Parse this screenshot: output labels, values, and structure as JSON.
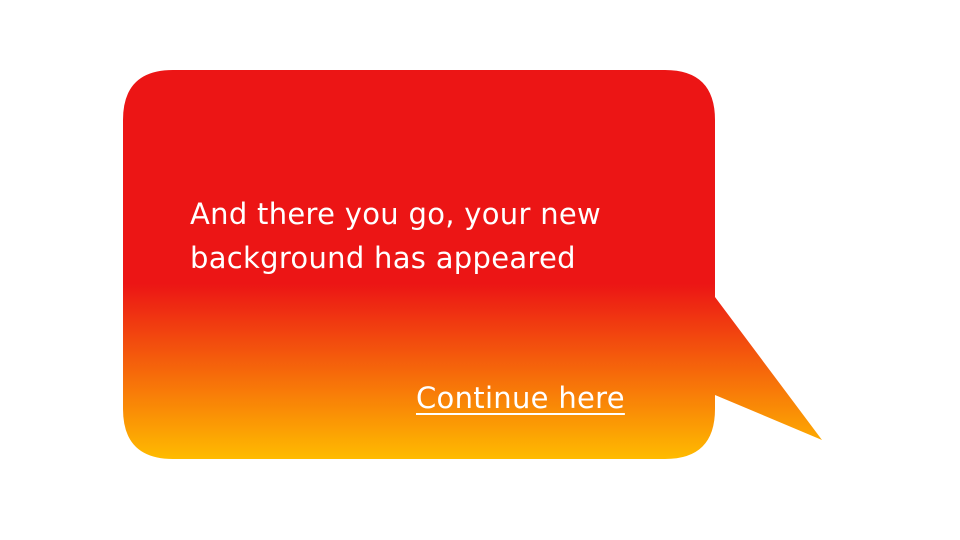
{
  "bubble": {
    "message": "And there you go, your new\nbackground has appeared",
    "continue_label": "Continue here",
    "colors": {
      "gradient_top": "#ec1515",
      "gradient_bottom": "#ffbb00",
      "text": "#ffffff"
    }
  }
}
